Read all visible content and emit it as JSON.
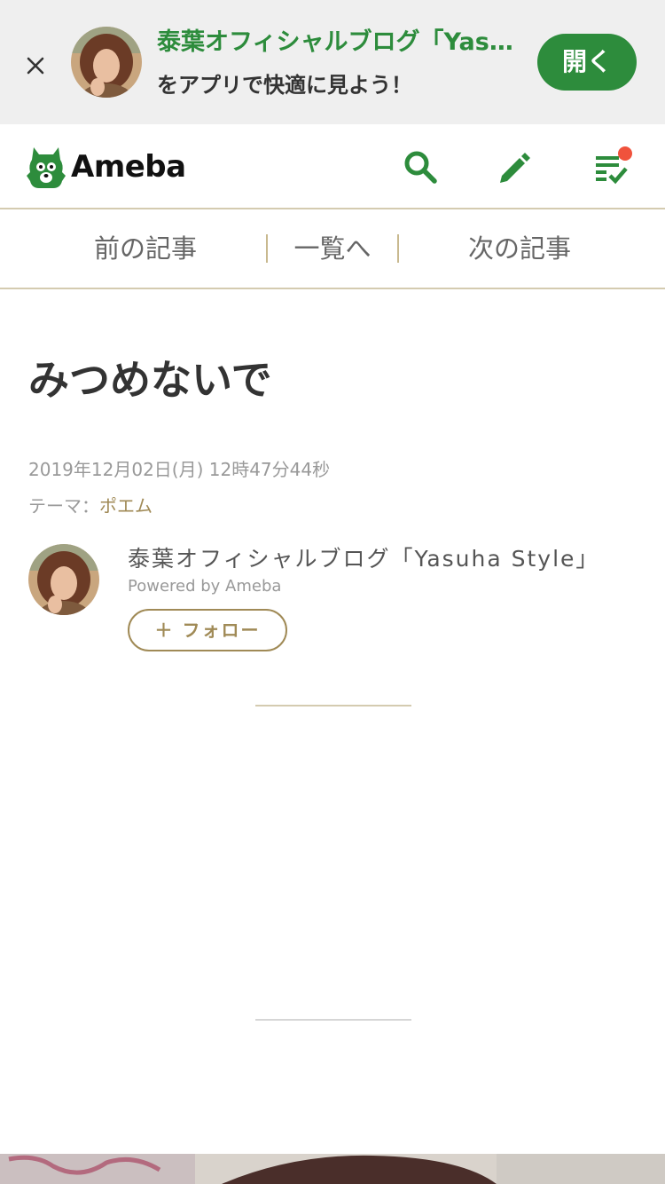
{
  "banner": {
    "title": "泰葉オフィシャルブログ「Yasuha Style」",
    "subtitle": "をアプリで快適に見よう！",
    "open_label": "開く"
  },
  "header": {
    "logo_text": "Ameba",
    "icons": [
      "search-icon",
      "pencil-icon",
      "checklist-icon"
    ],
    "accent_color": "#2d8c3c",
    "notification_dot_color": "#f0523c"
  },
  "pager": {
    "prev": "前の記事",
    "list": "一覧へ",
    "next": "次の記事"
  },
  "article": {
    "title": "みつめないで",
    "date": "2019年12月02日(月) 12時47分44秒",
    "theme_label": "テーマ：",
    "theme_value": "ポエム"
  },
  "author": {
    "blog_name": "泰葉オフィシャルブログ「Yasuha Style」",
    "powered": "Powered by Ameba",
    "follow_label": "＋ フォロー"
  }
}
